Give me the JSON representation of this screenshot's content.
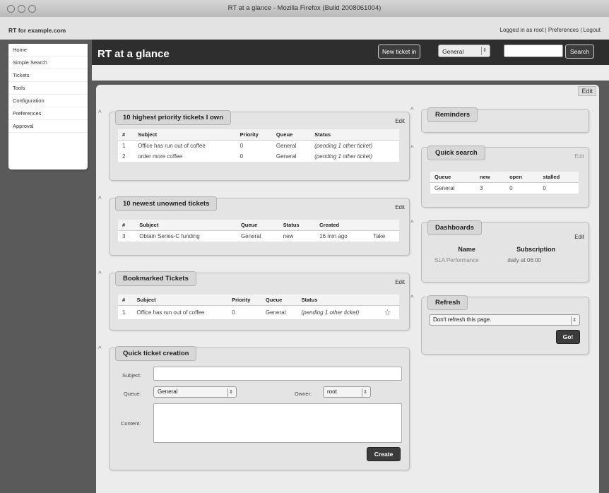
{
  "window": {
    "title": "RT at a glance - Mozilla Firefox (Build 2008061004)"
  },
  "site": {
    "name": "RT for example.com",
    "logged_in": "Logged in as root",
    "preferences": "Preferences",
    "logout": "Logout",
    "separator": " | "
  },
  "header": {
    "page_title": "RT at a glance",
    "new_ticket_label": "New ticket in",
    "queue_selected": "General",
    "search_label": "Search"
  },
  "nav": [
    "Home",
    "Simple Search",
    "Tickets",
    "Tools",
    "Configuration",
    "Preferences",
    "Approval"
  ],
  "page_edit_label": "Edit",
  "priority_box": {
    "title": "10 highest priority tickets I own",
    "edit_label": "Edit",
    "columns": [
      "#",
      "Subject",
      "Priority",
      "Queue",
      "Status"
    ],
    "rows": [
      [
        "1",
        "Office has run out of coffee",
        "0",
        "General",
        "(pending 1 other ticket)"
      ],
      [
        "2",
        "order more coffee",
        "0",
        "General",
        "(pending 1 other ticket)"
      ]
    ]
  },
  "newest_box": {
    "title": "10 newest unowned tickets",
    "edit_label": "Edit",
    "columns": [
      "#",
      "Subject",
      "Queue",
      "Status",
      "Created",
      ""
    ],
    "rows": [
      [
        "3",
        "Obtain Series-C funding",
        "General",
        "new",
        "16 min ago",
        "Take"
      ]
    ]
  },
  "bookmarked_box": {
    "title": "Bookmarked Tickets",
    "edit_label": "Edit",
    "columns": [
      "#",
      "Subject",
      "Priority",
      "Queue",
      "Status",
      ""
    ],
    "rows": [
      [
        "1",
        "Office has run out of coffee",
        "0",
        "General",
        "(pending 1 other ticket)",
        "☆"
      ]
    ]
  },
  "quick_create": {
    "title": "Quick ticket creation",
    "subject_label": "Subject:",
    "queue_label": "Queue:",
    "queue_value": "General",
    "owner_label": "Owner:",
    "owner_value": "root",
    "content_label": "Content:",
    "create_label": "Create"
  },
  "reminders_box": {
    "title": "Reminders"
  },
  "quick_search_box": {
    "title": "Quick search",
    "edit_label": "Edit",
    "columns": [
      "Queue",
      "new",
      "open",
      "stalled"
    ],
    "rows": [
      [
        "General",
        "3",
        "0",
        "0"
      ]
    ]
  },
  "dashboards_box": {
    "title": "Dashboards",
    "edit_label": "Edit",
    "columns": [
      "Name",
      "Subscription"
    ],
    "rows": [
      [
        "SLA Performance",
        "daily at 06:00"
      ]
    ]
  },
  "refresh_box": {
    "title": "Refresh",
    "select_value": "Don't refresh this page.",
    "go_label": "Go!"
  }
}
